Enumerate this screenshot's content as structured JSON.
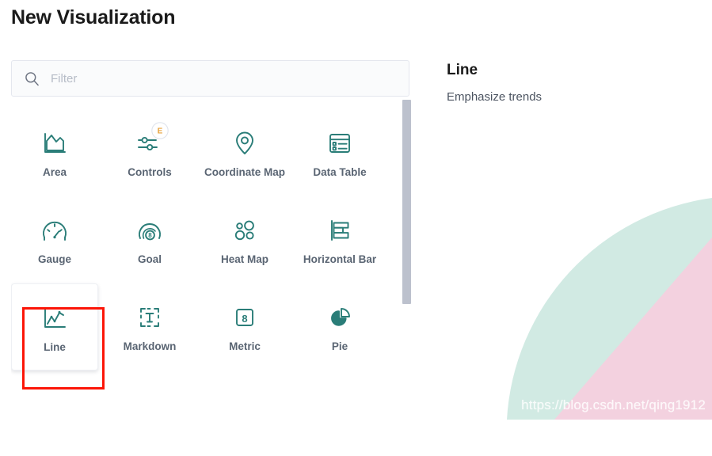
{
  "page": {
    "title": "New Visualization"
  },
  "search": {
    "placeholder": "Filter",
    "value": "",
    "icon": "search-icon"
  },
  "colors": {
    "icon_teal": "#2a7d78",
    "label_gray": "#5a6573",
    "badge_amber": "#e8a33d",
    "highlight_red": "#fc1507",
    "scrollbar": "#bcc1cd",
    "decor_mint": "#cfe9e2",
    "decor_pink": "#f3cfdd"
  },
  "grid": {
    "items": [
      {
        "label": "Area",
        "icon": "area-chart-icon",
        "selected": false,
        "badge": ""
      },
      {
        "label": "Controls",
        "icon": "controls-sliders-icon",
        "selected": false,
        "badge": "E"
      },
      {
        "label": "Coordinate Map",
        "icon": "map-pin-icon",
        "selected": false,
        "badge": ""
      },
      {
        "label": "Data Table",
        "icon": "data-table-icon",
        "selected": false,
        "badge": ""
      },
      {
        "label": "Gauge",
        "icon": "gauge-icon",
        "selected": false,
        "badge": ""
      },
      {
        "label": "Goal",
        "icon": "goal-icon",
        "selected": false,
        "badge": ""
      },
      {
        "label": "Heat Map",
        "icon": "heat-map-icon",
        "selected": false,
        "badge": ""
      },
      {
        "label": "Horizontal Bar",
        "icon": "horizontal-bar-icon",
        "selected": false,
        "badge": ""
      },
      {
        "label": "Line",
        "icon": "line-chart-icon",
        "selected": true,
        "badge": ""
      },
      {
        "label": "Markdown",
        "icon": "markdown-text-icon",
        "selected": false,
        "badge": ""
      },
      {
        "label": "Metric",
        "icon": "metric-icon",
        "selected": false,
        "badge": ""
      },
      {
        "label": "Pie",
        "icon": "pie-chart-icon",
        "selected": false,
        "badge": ""
      }
    ]
  },
  "detail": {
    "title": "Line",
    "description": "Emphasize trends"
  },
  "watermark": {
    "text": "https://blog.csdn.net/qing1912"
  }
}
